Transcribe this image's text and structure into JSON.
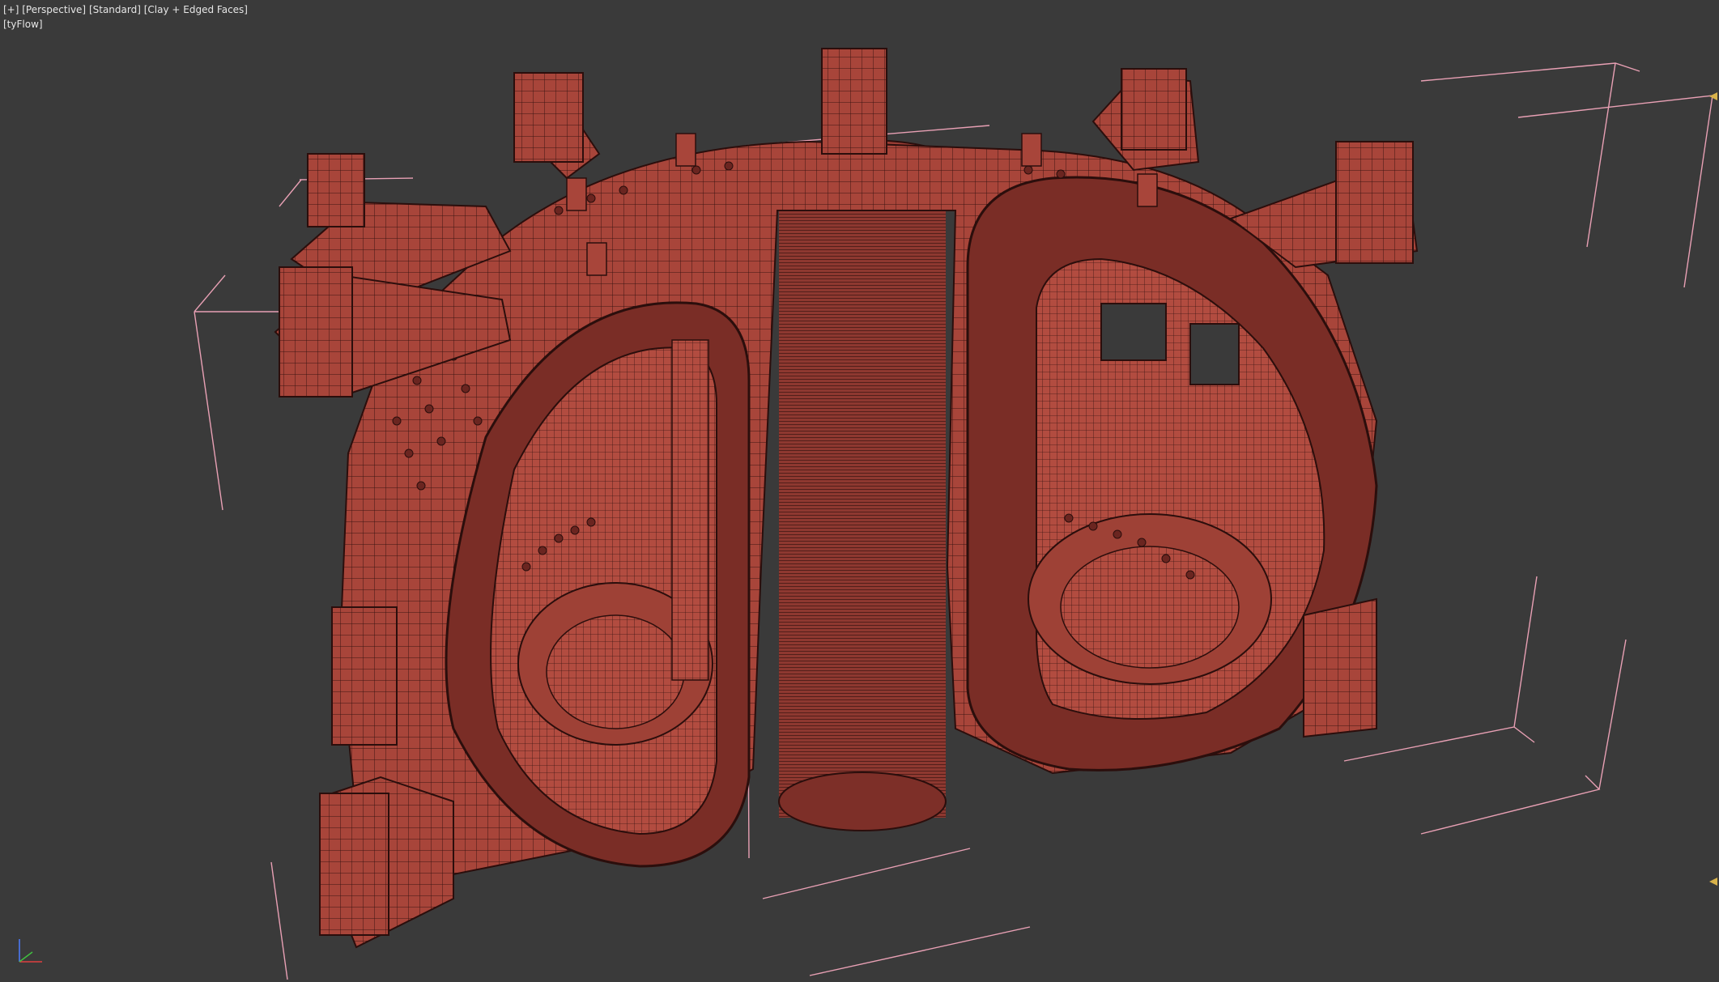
{
  "viewport": {
    "labels": {
      "plus": "[+]",
      "view": "[Perspective]",
      "mode": "[Standard]",
      "shading": "[Clay + Edged Faces]",
      "plugin": "[tyFlow]"
    }
  },
  "colors": {
    "background": "#3a3a3a",
    "model_fill": "#a8453a",
    "model_wire": "#3b1512",
    "bounding_box": "#e8a0b4",
    "marker": "#d8b24a",
    "label_text": "#e6e6e6"
  },
  "icons": [
    "axis-gizmo-icon",
    "viewport-edge-marker-icon"
  ]
}
